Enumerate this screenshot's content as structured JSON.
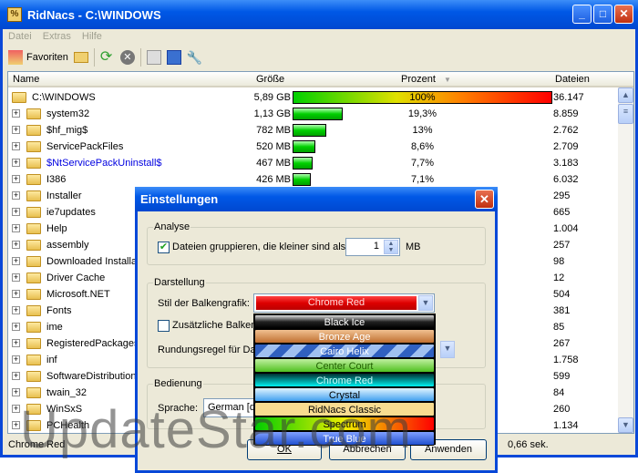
{
  "window": {
    "title": "RidNacs - C:\\WINDOWS"
  },
  "menu": [
    "Datei",
    "Extras",
    "Hilfe"
  ],
  "toolbar": {
    "favorites": "Favoriten"
  },
  "columns": {
    "name": "Name",
    "size": "Größe",
    "percent": "Prozent",
    "files": "Dateien"
  },
  "rows": [
    {
      "name": "C:\\WINDOWS",
      "size": "5,89 GB",
      "percent": "100%",
      "pct": 100,
      "files": "36.147"
    },
    {
      "name": "system32",
      "size": "1,13 GB",
      "percent": "19,3%",
      "pct": 19.3,
      "files": "8.859"
    },
    {
      "name": "$hf_mig$",
      "size": "782 MB",
      "percent": "13%",
      "pct": 13,
      "files": "2.762"
    },
    {
      "name": "ServicePackFiles",
      "size": "520 MB",
      "percent": "8,6%",
      "pct": 8.6,
      "files": "2.709"
    },
    {
      "name": "$NtServicePackUninstall$",
      "size": "467 MB",
      "percent": "7,7%",
      "pct": 7.7,
      "files": "3.183"
    },
    {
      "name": "I386",
      "size": "426 MB",
      "percent": "7,1%",
      "pct": 7.1,
      "files": "6.032"
    },
    {
      "name": "Installer",
      "files": "295"
    },
    {
      "name": "ie7updates",
      "files": "665"
    },
    {
      "name": "Help",
      "files": "1.004"
    },
    {
      "name": "assembly",
      "files": "257"
    },
    {
      "name": "Downloaded Installations",
      "files": "98"
    },
    {
      "name": "Driver Cache",
      "files": "12"
    },
    {
      "name": "Microsoft.NET",
      "files": "504"
    },
    {
      "name": "Fonts",
      "files": "381"
    },
    {
      "name": "ime",
      "files": "85"
    },
    {
      "name": "RegisteredPackages",
      "files": "267"
    },
    {
      "name": "inf",
      "files": "1.758"
    },
    {
      "name": "SoftwareDistribution",
      "files": "599"
    },
    {
      "name": "twain_32",
      "files": "84"
    },
    {
      "name": "WinSxS",
      "files": "260"
    },
    {
      "name": "PCHealth",
      "files": "1.134"
    }
  ],
  "status": {
    "left": "Chrome Red",
    "right": "0,66 sek."
  },
  "dialog": {
    "title": "Einstellungen",
    "analyse": "Analyse",
    "group_label": "Dateien gruppieren, die kleiner sind als:",
    "group_value": "1",
    "group_unit": "MB",
    "darstellung": "Darstellung",
    "bar_style_label": "Stil der Balkengrafik:",
    "bar_style_value": "Chrome Red",
    "extra_bars_label": "Zusätzliche Balken",
    "rounding_label": "Rundungsregel für Da",
    "bedienung": "Bedienung",
    "language_label": "Sprache:",
    "language_value": "German [d",
    "options": [
      "Black Ice",
      "Bronze Age",
      "Cairo Helix",
      "Center Court",
      "Chrome Red",
      "Crystal",
      "RidNacs Classic",
      "Spectrum",
      "True Blue"
    ],
    "ok": "OK",
    "cancel": "Abbrechen",
    "apply": "Anwenden"
  },
  "watermark": "UpdateStar.com"
}
